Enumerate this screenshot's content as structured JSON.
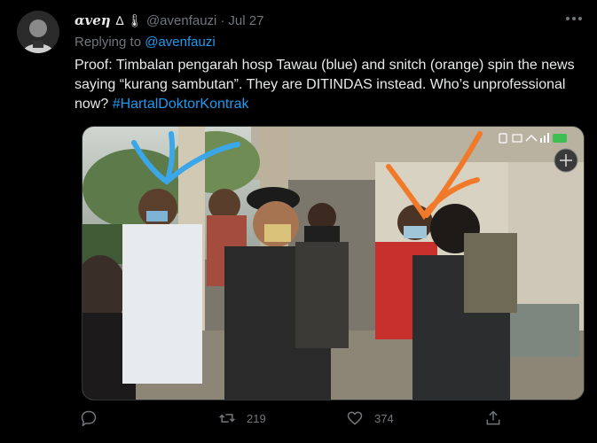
{
  "tweet": {
    "display_name": "αvеη",
    "name_glyphs": "∆ 🌡",
    "handle": "@avenfauzi",
    "separator": "·",
    "time": "Jul 27",
    "replying_prefix": "Replying to",
    "replying_handle": "@avenfauzi",
    "text": "Proof: Timbalan pengarah hosp Tawau (blue) and snitch (orange) spin the news saying “kurang sambutan”. They are DITINDAS instead. Who’s unprofessional now?",
    "hashtag": "#HartalDoktorKontrak"
  },
  "media": {
    "icons": [
      "bluetooth-icon",
      "vibrate-icon",
      "wifi-icon",
      "signal-icon",
      "battery-icon",
      "camera-switch-icon"
    ],
    "annotation_colors": {
      "blue": "#3ba6e8",
      "orange": "#f07a2a"
    }
  },
  "actions": {
    "reply_count": "",
    "retweet_count": "219",
    "like_count": "374"
  },
  "colors": {
    "background": "#000000",
    "text": "#e7e9ea",
    "muted": "#71767b",
    "link": "#1d9bf0"
  }
}
